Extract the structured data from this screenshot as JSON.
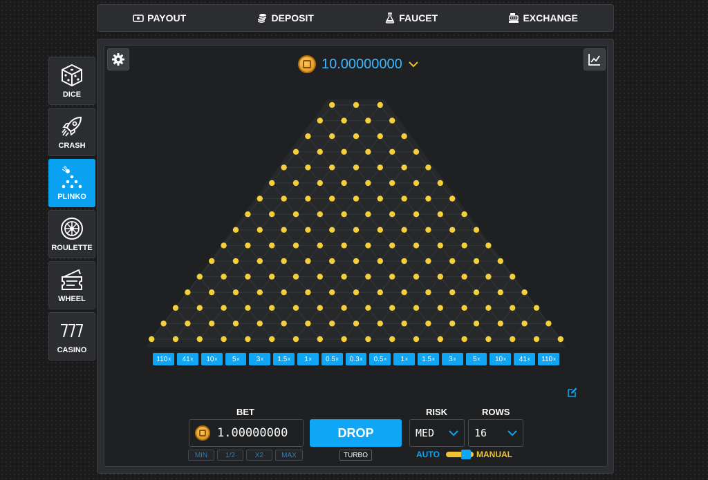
{
  "nav": {
    "items": [
      {
        "label": "PAYOUT",
        "icon": "money-icon"
      },
      {
        "label": "DEPOSIT",
        "icon": "coins-icon"
      },
      {
        "label": "FAUCET",
        "icon": "flask-icon"
      },
      {
        "label": "EXCHANGE",
        "icon": "cash-register-icon"
      }
    ]
  },
  "sidebar": {
    "items": [
      {
        "label": "DICE",
        "icon": "dice-icon",
        "active": false
      },
      {
        "label": "CRASH",
        "icon": "rocket-icon",
        "active": false
      },
      {
        "label": "PLINKO",
        "icon": "plinko-icon",
        "active": true
      },
      {
        "label": "ROULETTE",
        "icon": "roulette-icon",
        "active": false
      },
      {
        "label": "WHEEL",
        "icon": "wheel-ticket-icon",
        "active": false
      },
      {
        "label": "CASINO",
        "icon": "slots-777-icon",
        "active": false
      }
    ]
  },
  "balance": {
    "value": "10.00000000"
  },
  "board": {
    "rows": 16,
    "multipliers": [
      "110",
      "41",
      "10",
      "5",
      "3",
      "1.5",
      "1",
      "0.5",
      "0.3",
      "0.5",
      "1",
      "1.5",
      "3",
      "5",
      "10",
      "41",
      "110"
    ],
    "multiplier_suffix": "x"
  },
  "controls": {
    "bet_label": "BET",
    "bet_value": "1.00000000",
    "min_label": "MIN",
    "half_label": "1/2",
    "double_label": "X2",
    "max_label": "MAX",
    "drop_label": "DROP",
    "turbo_label": "TURBO",
    "risk_label": "RISK",
    "risk_value": "MED",
    "rows_label": "ROWS",
    "rows_value": "16",
    "auto_label": "AUTO",
    "manual_label": "MANUAL"
  },
  "colors": {
    "accent": "#0ea6f5",
    "peg": "#f5cf3a",
    "mode_auto": "#0ea6f5",
    "mode_manual": "#f1c232"
  }
}
